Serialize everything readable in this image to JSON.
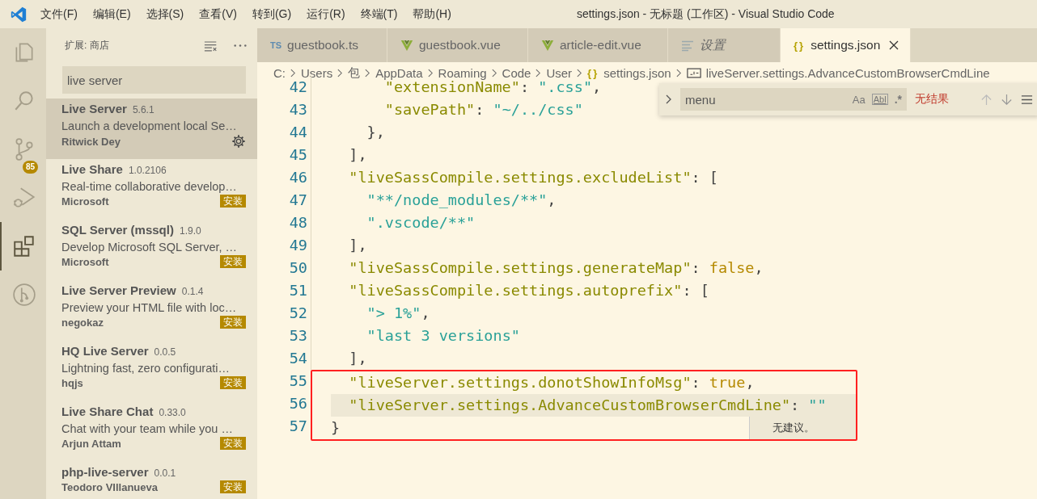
{
  "window": {
    "title": "settings.json - 无标题 (工作区) - Visual Studio Code"
  },
  "menu": [
    "文件(F)",
    "编辑(E)",
    "选择(S)",
    "查看(V)",
    "转到(G)",
    "运行(R)",
    "终端(T)",
    "帮助(H)"
  ],
  "activity_bar": [
    {
      "kind": "explorer",
      "selected": false
    },
    {
      "kind": "search",
      "selected": false
    },
    {
      "kind": "source-control",
      "selected": false,
      "badge": "85"
    },
    {
      "kind": "run",
      "selected": false
    },
    {
      "kind": "extensions",
      "selected": true
    },
    {
      "kind": "remote",
      "selected": false
    }
  ],
  "sidebar": {
    "title": "扩展: 商店",
    "search": {
      "value": "live server"
    },
    "extensions": [
      {
        "name": "Live Server",
        "version": "5.6.1",
        "description": "Launch a development local Se…",
        "publisher": "Ritwick Dey",
        "installed": true,
        "selected": true
      },
      {
        "name": "Live Share",
        "version": "1.0.2106",
        "description": "Real-time collaborative develop…",
        "publisher": "Microsoft",
        "installed": false,
        "install_label": "安装",
        "selected": false
      },
      {
        "name": "SQL Server (mssql)",
        "version": "1.9.0",
        "description": "Develop Microsoft SQL Server, …",
        "publisher": "Microsoft",
        "installed": false,
        "install_label": "安装",
        "selected": false
      },
      {
        "name": "Live Server Preview",
        "version": "0.1.4",
        "description": "Preview your HTML file with loc…",
        "publisher": "negokaz",
        "installed": false,
        "install_label": "安装",
        "selected": false
      },
      {
        "name": "HQ Live Server",
        "version": "0.0.5",
        "description": "Lightning fast, zero configurati…",
        "publisher": "hqjs",
        "installed": false,
        "install_label": "安装",
        "selected": false
      },
      {
        "name": "Live Share Chat",
        "version": "0.33.0",
        "description": "Chat with your team while you …",
        "publisher": "Arjun Attam",
        "installed": false,
        "install_label": "安装",
        "selected": false
      },
      {
        "name": "php-live-server",
        "version": "0.0.1",
        "publisher": "Teodoro VIllanueva",
        "installed": false,
        "install_label": "安装",
        "selected": false
      }
    ]
  },
  "tabs": [
    {
      "label": "guestbook.ts",
      "kind": "ts",
      "icon_text": "TS",
      "selected": false,
      "italic": false
    },
    {
      "label": "guestbook.vue",
      "kind": "vue",
      "selected": false,
      "italic": false
    },
    {
      "label": "article-edit.vue",
      "kind": "vue",
      "selected": false,
      "italic": false
    },
    {
      "label": "设置",
      "kind": "settings",
      "selected": false,
      "italic": true
    },
    {
      "label": "settings.json",
      "kind": "json",
      "icon_text": "{}",
      "selected": true,
      "italic": false
    }
  ],
  "breadcrumbs": [
    {
      "text": "C:",
      "kind": "folder"
    },
    {
      "text": "Users",
      "kind": "folder"
    },
    {
      "text": "包",
      "kind": "folder"
    },
    {
      "text": "AppData",
      "kind": "folder"
    },
    {
      "text": "Roaming",
      "kind": "folder"
    },
    {
      "text": "Code",
      "kind": "folder"
    },
    {
      "text": "User",
      "kind": "folder"
    },
    {
      "text": "settings.json",
      "kind": "json",
      "icon_text": "{}"
    },
    {
      "text": "liveServer.settings.AdvanceCustomBrowserCmdLine",
      "kind": "symbol"
    }
  ],
  "find_widget": {
    "value": "menu",
    "options": [
      "Aa",
      "Abl",
      ".*"
    ],
    "result": "无结果"
  },
  "code_blocks": [
    {
      "highlighted": false,
      "lines": [
        {
          "number": "42",
          "text": "      \"extensionName\": \".css\",",
          "current": false
        },
        {
          "number": "43",
          "text": "      \"savePath\": \"~/../css\"",
          "current": false
        },
        {
          "number": "44",
          "text": "    },",
          "current": false
        },
        {
          "number": "45",
          "text": "  ],",
          "current": false
        },
        {
          "number": "46",
          "text": "  \"liveSassCompile.settings.excludeList\": [",
          "current": false
        },
        {
          "number": "47",
          "text": "    \"**/node_modules/**\",",
          "current": false
        },
        {
          "number": "48",
          "text": "    \".vscode/**\"",
          "current": false
        },
        {
          "number": "49",
          "text": "  ],",
          "current": false
        },
        {
          "number": "50",
          "text": "  \"liveSassCompile.settings.generateMap\": false,",
          "current": false
        },
        {
          "number": "51",
          "text": "  \"liveSassCompile.settings.autoprefix\": [",
          "current": false
        },
        {
          "number": "52",
          "text": "    \"> 1%\",",
          "current": false
        },
        {
          "number": "53",
          "text": "    \"last 3 versions\"",
          "current": false
        },
        {
          "number": "54",
          "text": "  ],",
          "current": false
        }
      ]
    },
    {
      "highlighted": true,
      "lines": [
        {
          "number": "55",
          "text": "  \"liveServer.settings.donotShowInfoMsg\": true,",
          "current": false
        },
        {
          "number": "56",
          "text": "  \"liveServer.settings.AdvanceCustomBrowserCmdLine\": \"\"",
          "current": true
        },
        {
          "number": "57",
          "text": "}",
          "current": false
        }
      ]
    }
  ],
  "suggest_widget": {
    "message": "无建议。"
  }
}
